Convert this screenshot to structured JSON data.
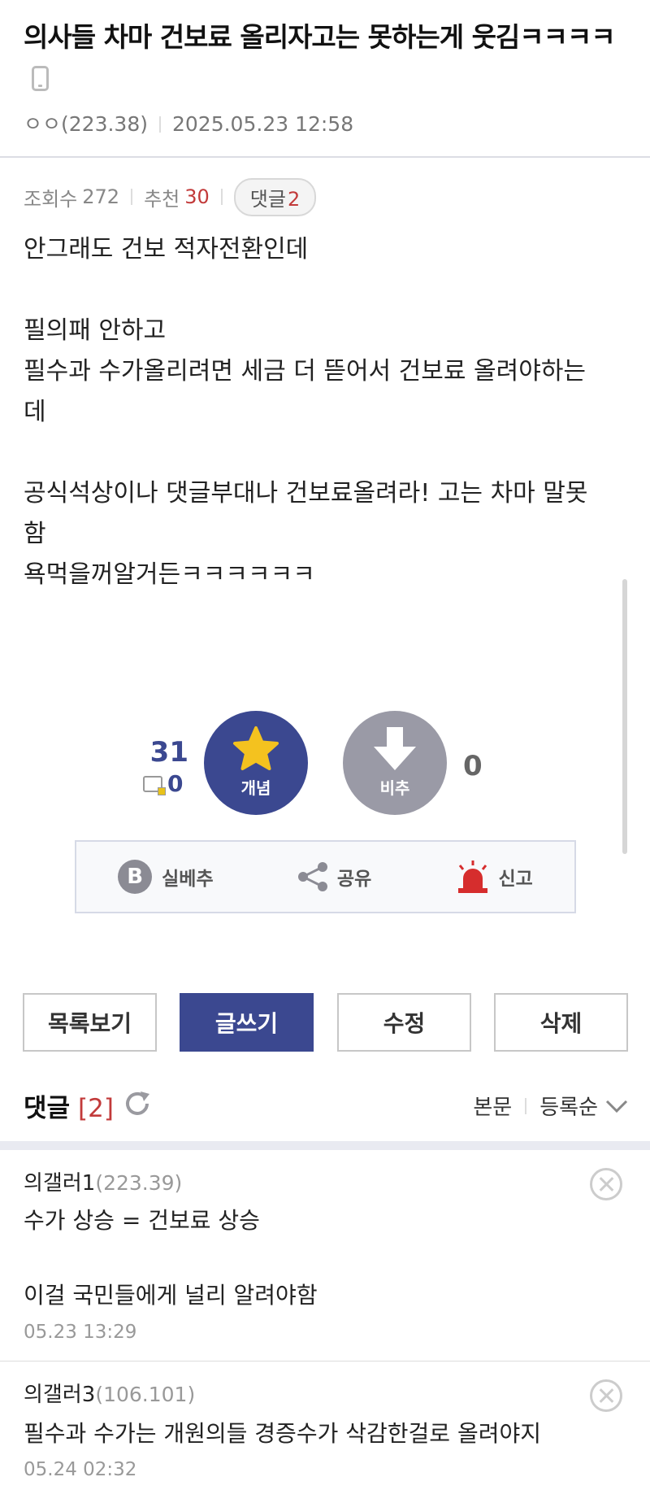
{
  "post": {
    "title": "의사들 차마 건보료 올리자고는 못하는게 웃김ㅋㅋㅋㅋ",
    "author": "ㅇㅇ(223.38)",
    "datetime": "2025.05.23 12:58",
    "stats": {
      "views_label": "조회수",
      "views": "272",
      "recommend_label": "추천",
      "recommend": "30",
      "comments_label": "댓글",
      "comments": "2"
    },
    "body_lines": [
      "안그래도 건보 적자전환인데",
      "",
      "필의패 안하고",
      "필수과 수가올리려면 세금 더 뜯어서 건보료 올려야하는",
      "데",
      "",
      "공식석상이나 댓글부대나 건보료올려라! 고는 차마 말못",
      "함",
      "욕먹을꺼알거든ㅋㅋㅋㅋㅋㅋ"
    ]
  },
  "vote": {
    "up_count": "31",
    "up_sub_count": "0",
    "up_label": "개념",
    "down_label": "비추",
    "down_count": "0"
  },
  "actions": {
    "realbest_label": "실베추",
    "share_label": "공유",
    "report_label": "신고"
  },
  "buttons": {
    "list": "목록보기",
    "write": "글쓰기",
    "edit": "수정",
    "delete": "삭제"
  },
  "comments_header": {
    "title": "댓글",
    "count": "[2]",
    "view_body": "본문",
    "sort": "등록순"
  },
  "comments": [
    {
      "author": "의갤러1",
      "ip": "(223.39)",
      "lines": [
        "수가 상승 = 건보료 상승",
        "",
        "이걸 국민들에게 널리 알려야함"
      ],
      "date": "05.23 13:29"
    },
    {
      "author": "의갤러3",
      "ip": "(106.101)",
      "lines": [
        "필수과 수가는 개원의들 경증수가 삭감한걸로 올려야지"
      ],
      "date": "05.24 02:32"
    }
  ],
  "colors": {
    "accent": "#3b4890",
    "highlight_red": "#c23a3a",
    "star": "#f4c21f",
    "report_red": "#d62d2d",
    "downvote_gray": "#9a9aa6"
  },
  "icons": {
    "device": "mobile-icon",
    "upvote": "star-icon",
    "downvote": "arrow-down-icon",
    "realbest": "b-badge-icon",
    "share": "share-icon",
    "report": "siren-icon",
    "refresh": "refresh-icon",
    "sort": "chevron-down-icon",
    "comment_delete": "close-circle-icon"
  }
}
